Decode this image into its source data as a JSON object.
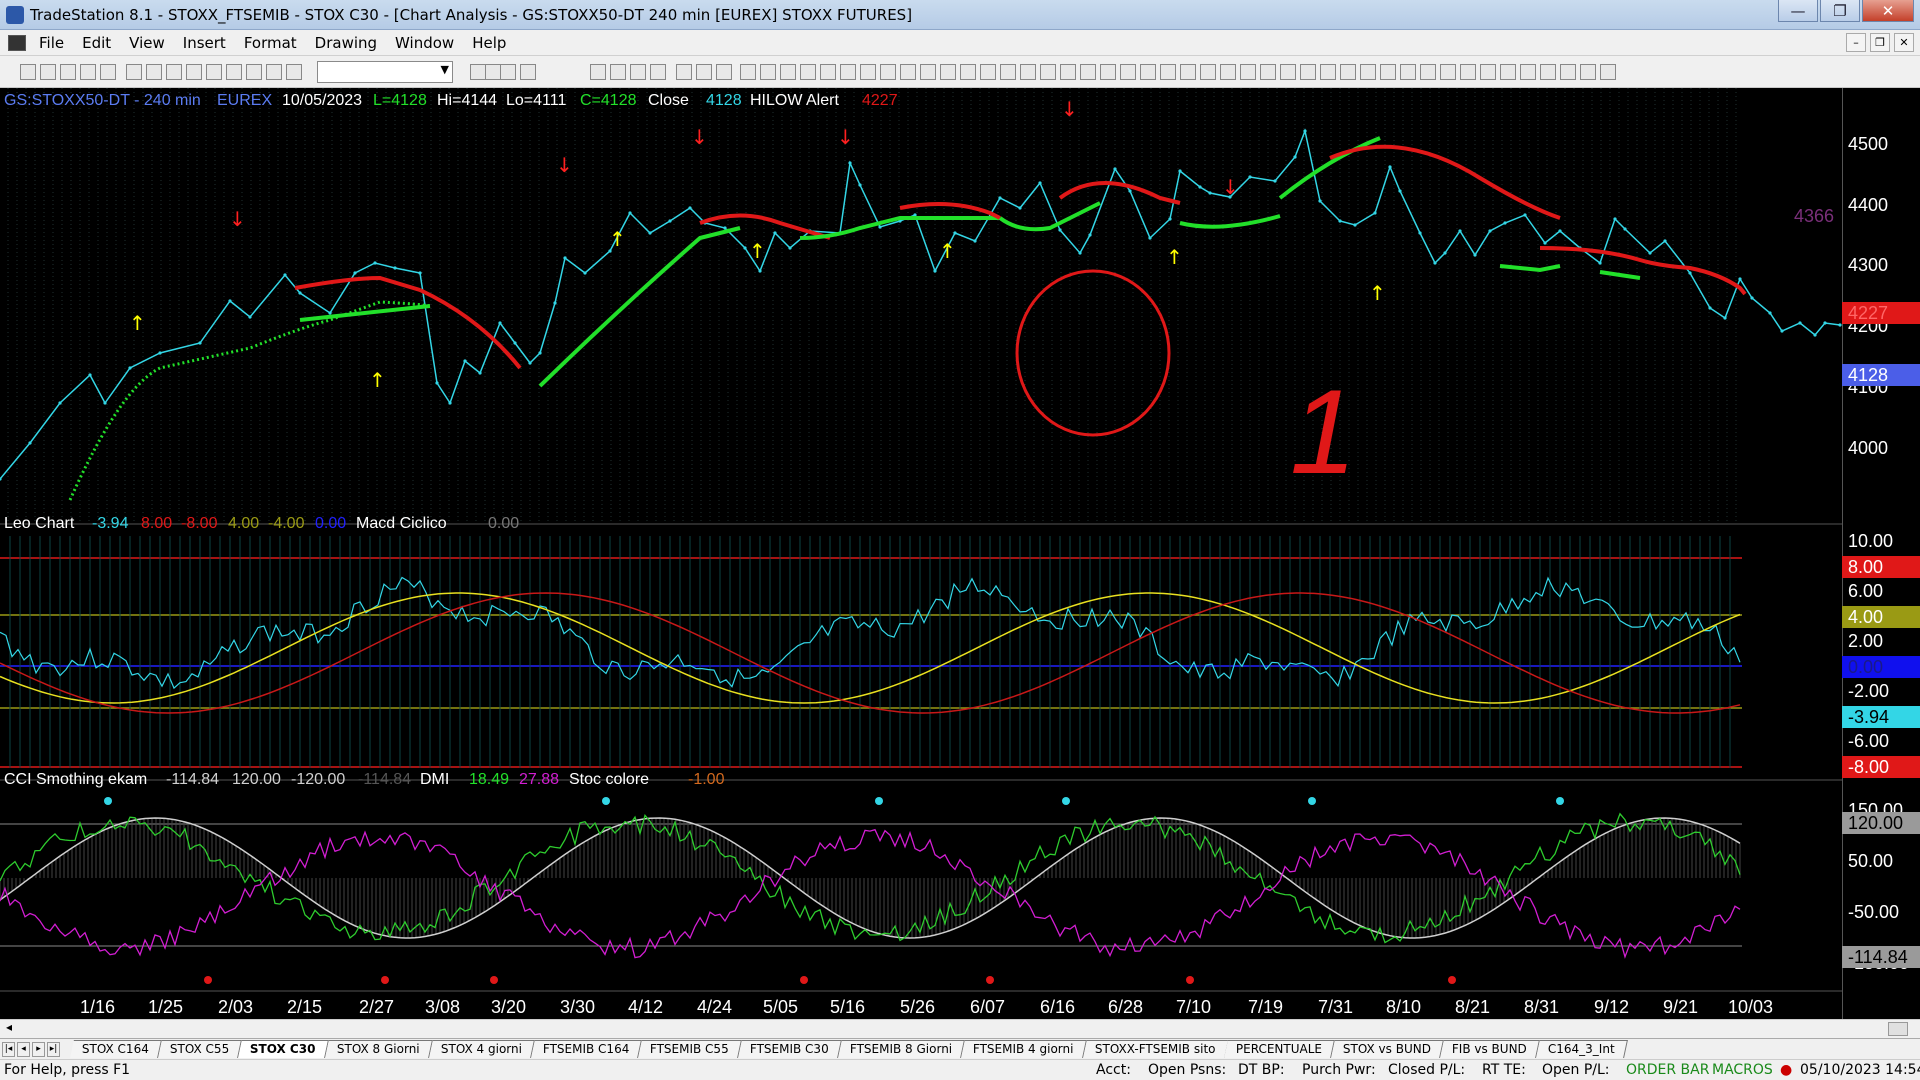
{
  "window": {
    "title": "TradeStation 8.1 - STOXX_FTSEMIB - STOX  C30 - [Chart Analysis - GS:STOXX50-DT  240 min  [EUREX] STOXX FUTURES]"
  },
  "window_controls": {
    "minimize": "—",
    "restore": "❐",
    "close": "✕"
  },
  "menu": [
    "File",
    "Edit",
    "View",
    "Insert",
    "Format",
    "Drawing",
    "Window",
    "Help"
  ],
  "mdi_controls": {
    "minimize": "–",
    "restore": "❐",
    "close": "✕"
  },
  "price_panel": {
    "symbol": "GS:STOXX50-DT - 240 min",
    "exchange": "EUREX",
    "date": "10/05/2023",
    "last": "L=4128",
    "high": "Hi=4144",
    "low": "Lo=4111",
    "close": "C=4128",
    "close_label": "Close",
    "close_value": "4128",
    "alert_label": "HILOW Alert",
    "alert_value": "4227",
    "axis_labels": [
      "4500",
      "4400",
      "4300",
      "4200",
      "4100",
      "4000"
    ],
    "badges": {
      "level": "4366",
      "alert": "4227",
      "last": "4128"
    },
    "annotation": "1"
  },
  "osc_panel": {
    "name": "Leo Chart",
    "v1": "-3.94",
    "v2": "8.00",
    "v3": "-8.00",
    "v4": "4.00",
    "v5": "-4.00",
    "v6": "0.00",
    "name2": "Macd Ciclico",
    "v7": "0.00",
    "axis_labels": [
      "10.00",
      "6.00",
      "2.00",
      "-2.00",
      "-6.00"
    ],
    "badges": {
      "upper": "8.00",
      "mid_upper": "4.00",
      "zero": "0.00",
      "current": "-3.94",
      "lower": "-8.00"
    }
  },
  "cci_panel": {
    "name": "CCI Smothing ekam",
    "v1": "-114.84",
    "v2": "120.00",
    "v3": "-120.00",
    "v4": "-114.84",
    "dmi_label": "DMI",
    "dmi1": "18.49",
    "dmi2": "27.88",
    "stoc_label": "Stoc colore",
    "stoc_value": "-1.00",
    "axis_labels": [
      "150.00",
      "50.00",
      "-50.00",
      "-150.00"
    ],
    "badges": {
      "upper": "120.00",
      "current": "-114.84"
    }
  },
  "date_axis": [
    "1/16",
    "1/25",
    "2/03",
    "2/15",
    "2/27",
    "3/08",
    "3/20",
    "3/30",
    "4/12",
    "4/24",
    "5/05",
    "5/16",
    "5/26",
    "6/07",
    "6/16",
    "6/28",
    "7/10",
    "7/19",
    "7/31",
    "8/10",
    "8/21",
    "8/31",
    "9/12",
    "9/21",
    "10/03"
  ],
  "tabs": [
    "STOX C164",
    "STOX C55",
    "STOX C30",
    "STOX 8 Giorni",
    "STOX 4 giorni",
    "FTSEMIB C164",
    "FTSEMIB C55",
    "FTSEMIB C30",
    "FTSEMIB 8 Giorni",
    "FTSEMIB 4 giorni",
    "STOXX-FTSEMIB sito",
    "PERCENTUALE",
    "STOX vs BUND",
    "FIB vs BUND",
    "C164_3_Int"
  ],
  "active_tab": "STOX C30",
  "status": {
    "help": "For Help, press F1",
    "acct": "Acct:",
    "open_psns": "Open Psns:",
    "dt_bp": "DT BP:",
    "purch_pwr": "Purch Pwr:",
    "closed_pl": "Closed P/L:",
    "rt_te": "RT TE:",
    "open_pl": "Open P/L:",
    "order_bar": "ORDER BAR",
    "macros": "MACROS",
    "datetime": "05/10/2023 14:54"
  },
  "colors": {
    "price": "#33d6e6",
    "up_trend": "#22e02a",
    "down_trend": "#e01818",
    "arrow_up": "#ffff00",
    "arrow_down": "#ff2020",
    "osc_yellow": "#e8e020",
    "cci_magenta": "#d21ed2",
    "cci_green": "#2ecc2e"
  }
}
